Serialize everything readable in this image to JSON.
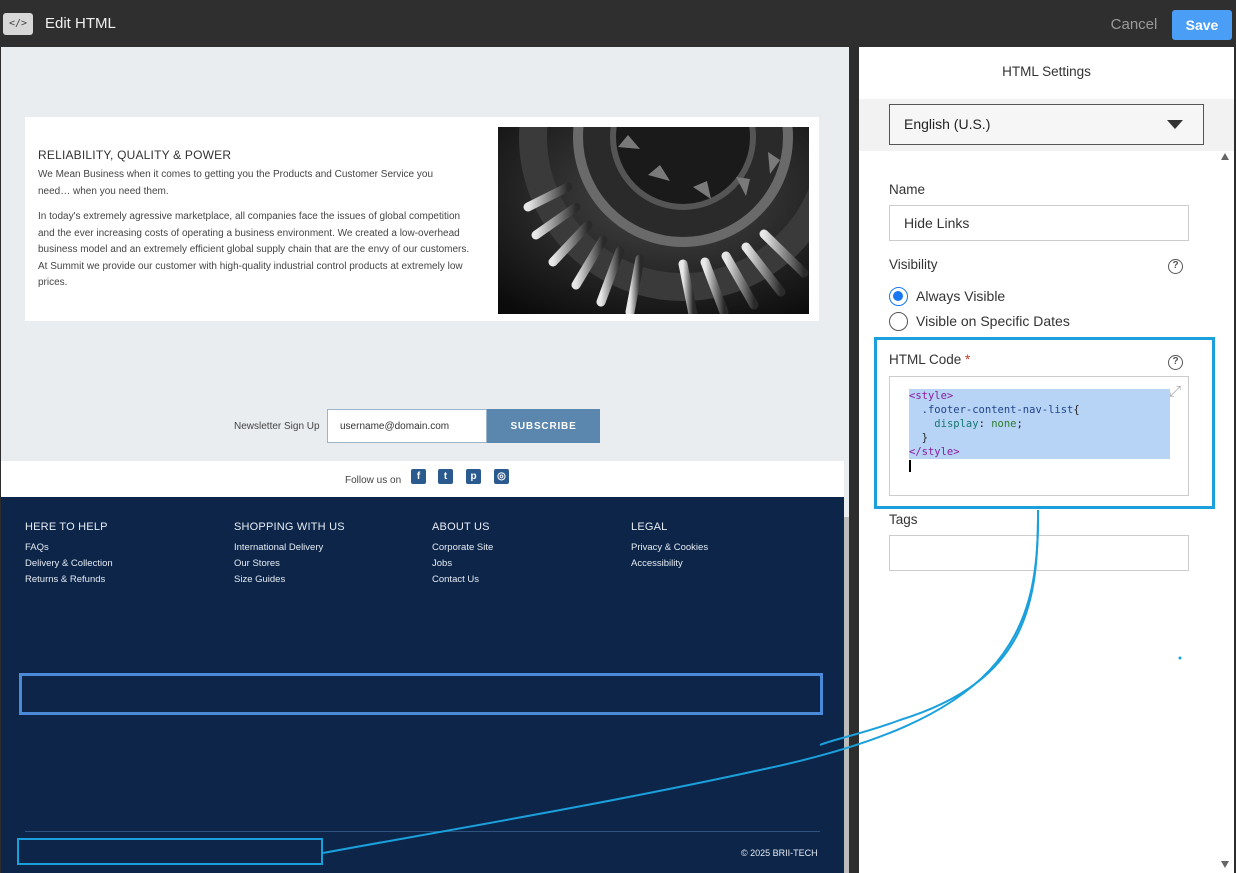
{
  "topbar": {
    "icon": "</>",
    "title": "Edit HTML",
    "cancel": "Cancel",
    "save": "Save"
  },
  "preview": {
    "promo": {
      "heading": "RELIABILITY, QUALITY & POWER",
      "p1": "We Mean Business when it comes to getting you the Products and Customer Service you need… when you need them.",
      "p2": "In today's extremely agressive marketplace, all companies face the issues of global competition and the ever increasing costs of operating a business environment. We created a low-overhead business model and an extremely efficient global supply chain that are the envy of our customers. At Summit we provide our customer with high-quality industrial control products at extremely low prices.",
      "image": "gear-image"
    },
    "newsletter": {
      "label": "Newsletter Sign Up",
      "value": "username@domain.com",
      "button": "SUBSCRIBE"
    },
    "follow": {
      "label": "Follow us on",
      "icons": [
        "facebook-icon",
        "twitter-icon",
        "pinterest-icon",
        "instagram-icon"
      ]
    },
    "footer": {
      "columns": [
        {
          "title": "HERE TO HELP",
          "links": [
            "FAQs",
            "Delivery & Collection",
            "Returns & Refunds"
          ]
        },
        {
          "title": "SHOPPING WITH US",
          "links": [
            "International Delivery",
            "Our Stores",
            "Size Guides"
          ]
        },
        {
          "title": "ABOUT US",
          "links": [
            "Corporate Site",
            "Jobs",
            "Contact Us"
          ]
        },
        {
          "title": "LEGAL",
          "links": [
            "Privacy & Cookies",
            "Accessibility"
          ]
        }
      ],
      "copyright": "© 2025 BRII-TECH"
    }
  },
  "settings": {
    "header": "HTML Settings",
    "language": "English (U.S.)",
    "name_label": "Name",
    "name_value": "Hide Links",
    "visibility_label": "Visibility",
    "visibility_options": [
      "Always Visible",
      "Visible on Specific Dates"
    ],
    "visibility_selected": "Always Visible",
    "code_label": "HTML Code",
    "required_mark": "*",
    "code": {
      "line1": "<style>",
      "selector": ".footer-content-nav-list",
      "brace_open": "{",
      "property": "display",
      "colon": ": ",
      "value": "none",
      "semicolon": ";",
      "brace_close": "}",
      "line5": "</style>"
    },
    "tags_label": "Tags",
    "tags_value": ""
  },
  "colors": {
    "accent": "#4a9ef5",
    "highlight": "#1ba0dc",
    "footer_bg": "#0c2549",
    "radio": "#1877f2"
  }
}
